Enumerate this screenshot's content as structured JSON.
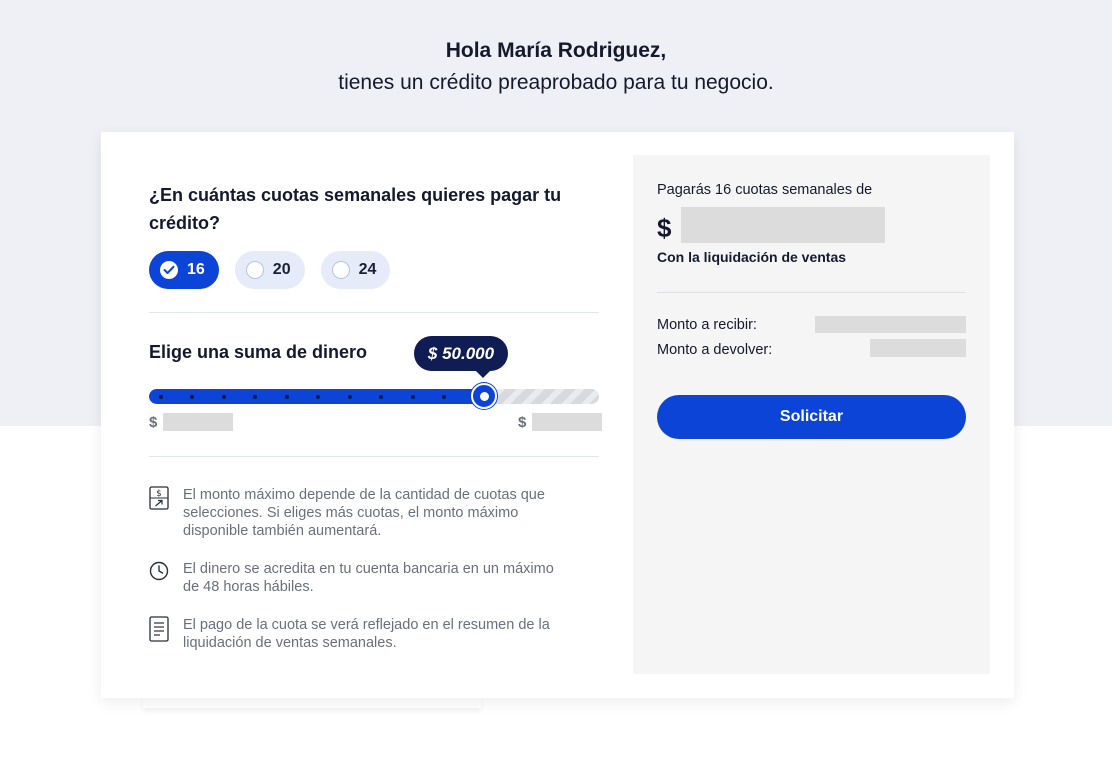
{
  "greeting": {
    "name": "Hola María Rodriguez,",
    "subtitle": "tienes un crédito preaprobado para tu negocio."
  },
  "installments": {
    "question": "¿En cuántas cuotas semanales quieres pagar tu crédito?",
    "options": [
      "16",
      "20",
      "24"
    ],
    "selected": "16"
  },
  "amount": {
    "title": "Elige una suma de dinero",
    "selected_value": "$ 50.000",
    "slider_level": 0.745,
    "min_currency": "$",
    "max_currency": "$"
  },
  "info": [
    {
      "icon": "money-exchange-icon",
      "text": "El monto máximo depende de la cantidad de cuotas que selecciones. Si eliges más cuotas, el monto máximo disponible también aumentará."
    },
    {
      "icon": "clock-icon",
      "text": "El dinero se acredita en tu cuenta bancaria en un máximo de 48 horas hábiles."
    },
    {
      "icon": "receipt-icon",
      "text": "El pago de la cuota se verá reflejado en el resumen de la liquidación de ventas semanales."
    }
  ],
  "summary": {
    "pay_line": "Pagarás 16 cuotas semanales de",
    "currency": "$",
    "settlement_note": "Con la liquidación de ventas",
    "receive_label": "Monto a recibir:",
    "return_label": "Monto a devolver:",
    "submit_label": "Solicitar"
  },
  "colors": {
    "primary": "#0b44d6",
    "bubble": "#0f1d54",
    "background_band": "#eef0f5"
  }
}
